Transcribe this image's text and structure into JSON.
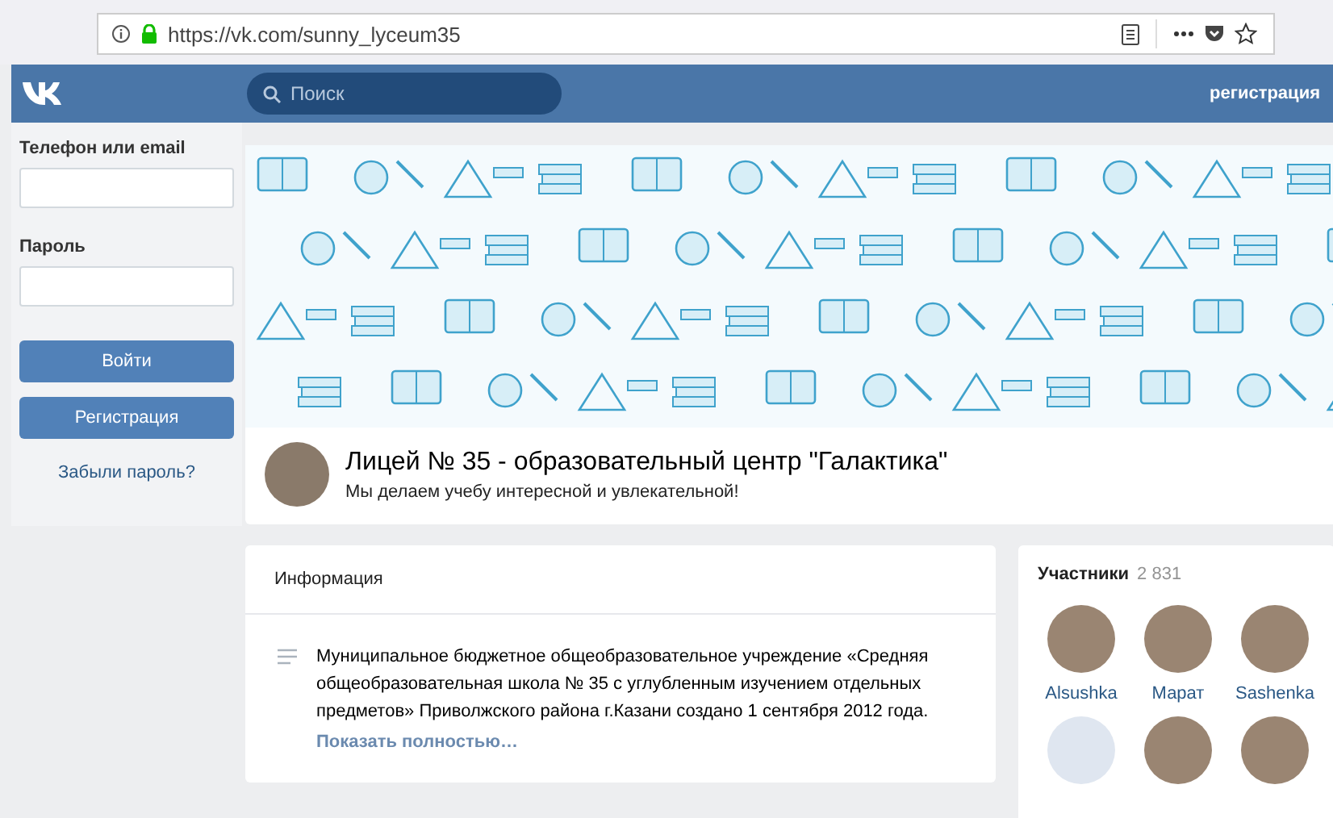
{
  "browser": {
    "url": "https://vk.com/sunny_lyceum35"
  },
  "header": {
    "search": {
      "placeholder": "Поиск"
    },
    "register_link": "регистрация"
  },
  "login": {
    "phone_label": "Телефон или email",
    "password_label": "Пароль",
    "login_button": "Войти",
    "register_button": "Регистрация",
    "forgot_link": "Забыли пароль?"
  },
  "group": {
    "title": "Лицей № 35 - образовательный центр \"Галактика\"",
    "status": "Мы делаем учебу интересной и увлекательной!"
  },
  "info": {
    "title": "Информация",
    "description": "Муниципальное бюджетное общеобразовательное учреждение «Средняя общеобразовательная школа № 35 с углубленным изучением отдельных предметов» Приволжского района г.Казани создано 1 сентября 2012 года.",
    "more_link": "Показать полностью…"
  },
  "members": {
    "title": "Участники",
    "count": "2 831",
    "items": [
      {
        "name": "Alsushka"
      },
      {
        "name": "Марат"
      },
      {
        "name": "Sashenka"
      },
      {
        "kind": "default"
      },
      {
        "kind": "photo"
      },
      {
        "kind": "photo"
      }
    ]
  }
}
